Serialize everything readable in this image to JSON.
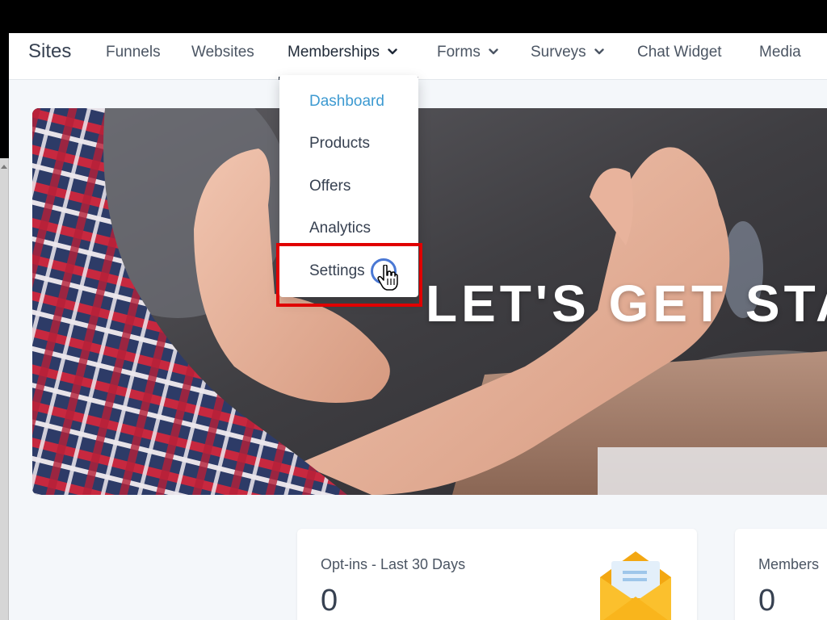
{
  "nav": {
    "title": "Sites",
    "items": [
      {
        "label": "Funnels",
        "has_dropdown": false
      },
      {
        "label": "Websites",
        "has_dropdown": false
      },
      {
        "label": "Memberships",
        "has_dropdown": true,
        "active": true
      },
      {
        "label": "Forms",
        "has_dropdown": true
      },
      {
        "label": "Surveys",
        "has_dropdown": true
      },
      {
        "label": "Chat Widget",
        "has_dropdown": false
      },
      {
        "label": "Media",
        "has_dropdown": false
      }
    ]
  },
  "dropdown": {
    "items": [
      {
        "label": "Dashboard",
        "active": true
      },
      {
        "label": "Products"
      },
      {
        "label": "Offers"
      },
      {
        "label": "Analytics"
      },
      {
        "label": "Settings",
        "highlighted": true
      }
    ]
  },
  "hero": {
    "text": "LET'S GET STA"
  },
  "cards": [
    {
      "title": "Opt-ins - Last 30 Days",
      "value": "0",
      "icon": "envelope-icon"
    },
    {
      "title": "Members",
      "value": "0"
    }
  ],
  "colors": {
    "accent": "#3d9ad1",
    "highlight_box": "#e00000",
    "cursor_ring": "#4a78d4"
  }
}
